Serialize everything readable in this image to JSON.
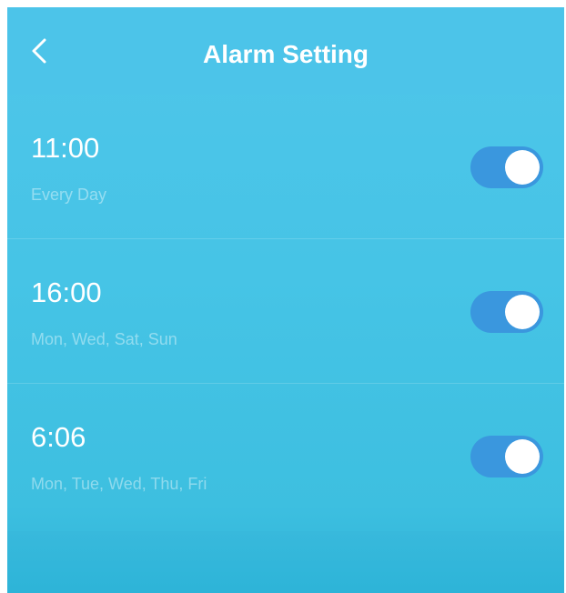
{
  "header": {
    "title": "Alarm Setting",
    "back_icon": "chevron-left-icon"
  },
  "alarms": [
    {
      "time": "11:00",
      "repeat": "Every Day",
      "enabled": true
    },
    {
      "time": "16:00",
      "repeat": "Mon, Wed, Sat, Sun",
      "enabled": true
    },
    {
      "time": "6:06",
      "repeat": "Mon, Tue, Wed, Thu, Fri",
      "enabled": true
    }
  ],
  "colors": {
    "background": "#46c4e6",
    "toggle_on": "#3a97de",
    "text": "#ffffff"
  }
}
